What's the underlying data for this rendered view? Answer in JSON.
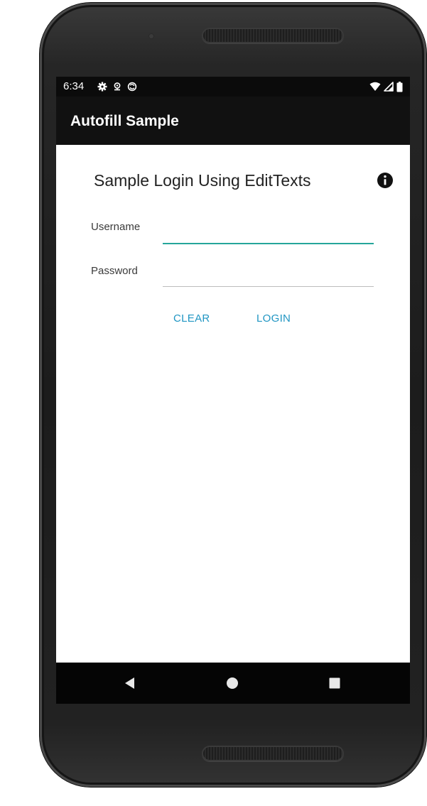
{
  "status_bar": {
    "time": "6:34",
    "left_icons": [
      "settings-gear-icon",
      "location-pin-icon",
      "sync-circle-icon"
    ],
    "right_icons": [
      "wifi-icon",
      "cell-signal-icon",
      "battery-icon"
    ]
  },
  "app_bar": {
    "title": "Autofill Sample"
  },
  "main": {
    "title": "Sample Login Using EditTexts",
    "info_icon": "info-icon",
    "username": {
      "label": "Username",
      "value": ""
    },
    "password": {
      "label": "Password",
      "value": ""
    },
    "buttons": {
      "clear": "CLEAR",
      "login": "LOGIN"
    }
  },
  "nav_bar": {
    "icons": [
      "back-triangle-icon",
      "home-circle-icon",
      "recents-square-icon"
    ]
  },
  "colors": {
    "app_bar": "#111111",
    "status_bar": "#0b0b0b",
    "accent_underline": "#26a69a",
    "button_text": "#2196c3",
    "nav_bar": "#050505"
  }
}
